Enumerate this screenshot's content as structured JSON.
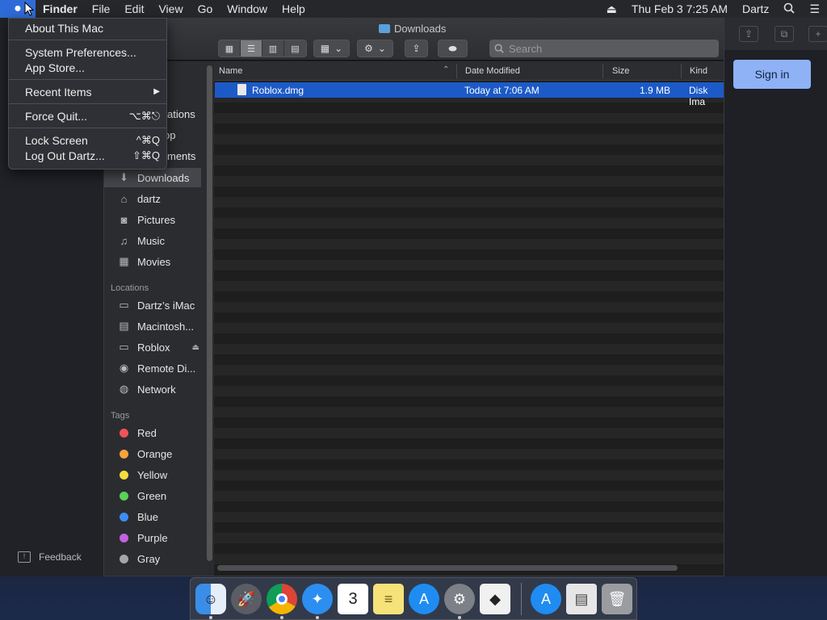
{
  "menubar": {
    "app_name": "Finder",
    "menus": [
      "File",
      "Edit",
      "View",
      "Go",
      "Window",
      "Help"
    ],
    "clock": "Thu Feb 3  7:25 AM",
    "user": "Dartz"
  },
  "apple_menu": {
    "about": "About This Mac",
    "sysprefs": "System Preferences...",
    "appstore": "App Store...",
    "recent": "Recent Items",
    "recent_arrow": "▶",
    "forcequit": "Force Quit...",
    "forcequit_sc": "⌥⌘⎋",
    "lock": "Lock Screen",
    "lock_sc": "^⌘Q",
    "logout": "Log Out Dartz...",
    "logout_sc": "⇧⌘Q"
  },
  "window": {
    "title": "Downloads",
    "search_placeholder": "Search"
  },
  "sidebar": {
    "partial_items": [
      "ts",
      "ations",
      "op",
      "ments"
    ],
    "favorites": [
      {
        "label": "Downloads",
        "icon": "download-icon"
      },
      {
        "label": "dartz",
        "icon": "home-icon"
      },
      {
        "label": "Pictures",
        "icon": "camera-icon"
      },
      {
        "label": "Music",
        "icon": "music-icon"
      },
      {
        "label": "Movies",
        "icon": "film-icon"
      }
    ],
    "locations_header": "Locations",
    "locations": [
      {
        "label": "Dartz’s iMac",
        "icon": "display-icon"
      },
      {
        "label": "Macintosh...",
        "icon": "disk-icon"
      },
      {
        "label": "Roblox",
        "icon": "disk-icon"
      },
      {
        "label": "Remote Di...",
        "icon": "cd-icon"
      },
      {
        "label": "Network",
        "icon": "globe-icon"
      }
    ],
    "tags_header": "Tags",
    "tags": [
      {
        "label": "Red",
        "color": "#f0525a"
      },
      {
        "label": "Orange",
        "color": "#f6a33b"
      },
      {
        "label": "Yellow",
        "color": "#f5dd3b"
      },
      {
        "label": "Green",
        "color": "#5bd158"
      },
      {
        "label": "Blue",
        "color": "#3b8ef5"
      },
      {
        "label": "Purple",
        "color": "#c261e0"
      },
      {
        "label": "Gray",
        "color": "#a5a5a8"
      }
    ]
  },
  "columns": {
    "name": "Name",
    "date": "Date Modified",
    "size": "Size",
    "kind": "Kind"
  },
  "files": [
    {
      "name": "Roblox.dmg",
      "date": "Today at 7:06 AM",
      "size": "1.9 MB",
      "kind": "Disk Ima"
    }
  ],
  "right_panel": {
    "signin": "Sign in"
  },
  "feedback": "Feedback",
  "accent": "#1c5ac8"
}
